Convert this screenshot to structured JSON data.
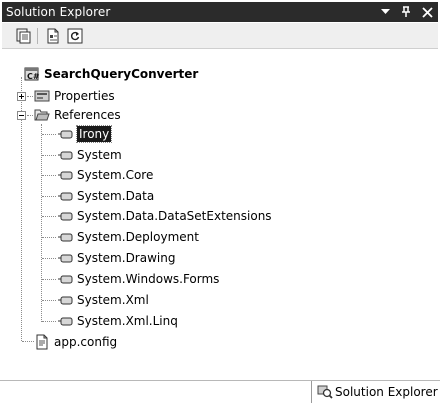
{
  "panel": {
    "title": "Solution Explorer",
    "controls": [
      {
        "icon": "dropdown-arrow-icon"
      },
      {
        "icon": "pin-icon"
      },
      {
        "icon": "close-icon"
      }
    ]
  },
  "toolbar": {
    "buttons": [
      {
        "icon": "show-all-files-icon"
      },
      {
        "icon": "properties-icon"
      },
      {
        "icon": "refresh-icon"
      }
    ]
  },
  "tree": {
    "project": "SearchQueryConverter",
    "properties": "Properties",
    "references": {
      "label": "References",
      "items": [
        "Irony",
        "System",
        "System.Core",
        "System.Data",
        "System.Data.DataSetExtensions",
        "System.Deployment",
        "System.Drawing",
        "System.Windows.Forms",
        "System.Xml",
        "System.Xml.Linq"
      ],
      "selected": "Irony"
    },
    "files": [
      "app.config"
    ]
  },
  "bottom_tab": {
    "label": "Solution Explorer",
    "icon": "solution-explorer-icon"
  }
}
